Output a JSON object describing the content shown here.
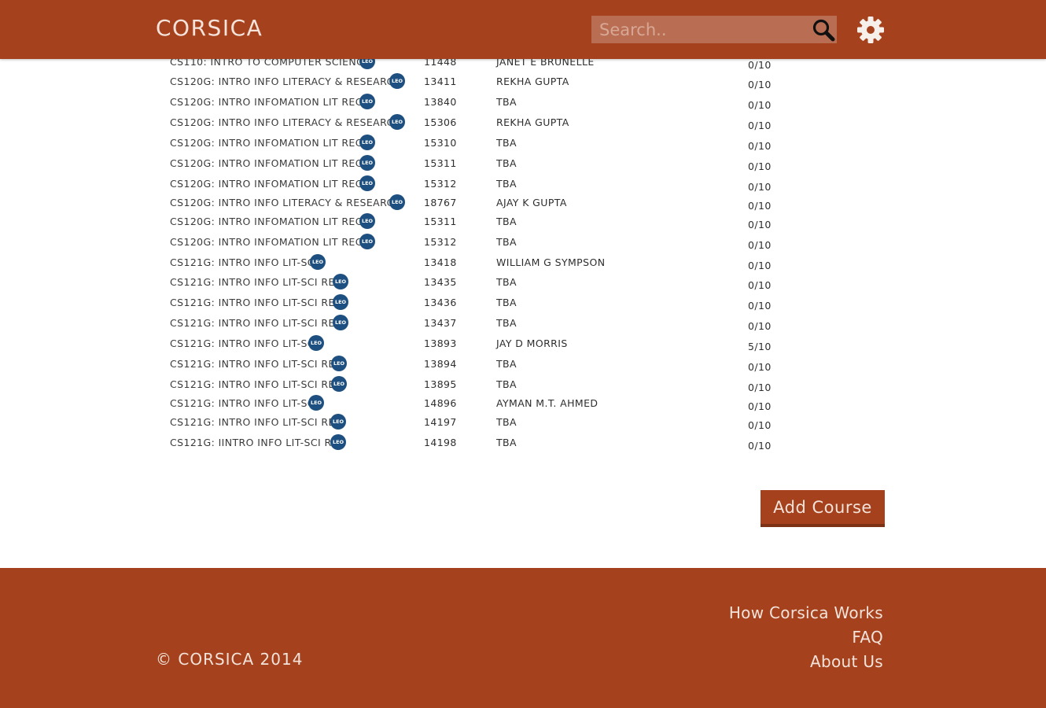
{
  "header": {
    "brand": "CORSICA",
    "search_placeholder": "Search..",
    "colors": {
      "brand": "#a5421d",
      "search_bg": "#b96d52",
      "header_text": "#f3e3da"
    }
  },
  "leo_badge": "LEO",
  "courses": [
    {
      "name": "CS110: INTRO TO COMPUTER SCIENCE",
      "leo": true,
      "number": "11448",
      "instructor": "JANET E BRUNELLE",
      "seats": "0/10"
    },
    {
      "name": "CS120G: INTRO INFO LITERACY & RESEARCH",
      "leo": true,
      "number": "13411",
      "instructor": "REKHA GUPTA",
      "seats": "0/10"
    },
    {
      "name": "CS120G: INTRO INFOMATION LIT REC",
      "leo": true,
      "number": "13840",
      "instructor": "TBA",
      "seats": "0/10"
    },
    {
      "name": "CS120G: INTRO INFO LITERACY & RESEARCH",
      "leo": true,
      "number": "15306",
      "instructor": "REKHA GUPTA",
      "seats": "0/10"
    },
    {
      "name": "CS120G: INTRO INFOMATION LIT REC",
      "leo": true,
      "number": "15310",
      "instructor": "TBA",
      "seats": "0/10"
    },
    {
      "name": "CS120G: INTRO INFOMATION LIT REC",
      "leo": true,
      "number": "15311",
      "instructor": "TBA",
      "seats": "0/10"
    },
    {
      "name": "CS120G: INTRO INFOMATION LIT REC",
      "leo": true,
      "number": "15312",
      "instructor": "TBA",
      "seats": "0/10"
    },
    {
      "name": "CS120G: INTRO INFO LITERACY & RESEARCH",
      "leo": true,
      "number": "18767",
      "instructor": "AJAY K GUPTA",
      "seats": "0/10"
    },
    {
      "name": "CS120G: INTRO INFOMATION LIT REC",
      "leo": true,
      "number": "15311",
      "instructor": "TBA",
      "seats": "0/10"
    },
    {
      "name": "CS120G: INTRO INFOMATION LIT REC",
      "leo": true,
      "number": "15312",
      "instructor": "TBA",
      "seats": "0/10"
    },
    {
      "name": "CS121G: INTRO INFO LIT-SCI",
      "leo": true,
      "number": "13418",
      "instructor": "WILLIAM G SYMPSON",
      "seats": "0/10"
    },
    {
      "name": "CS121G: INTRO INFO LIT-SCI REC",
      "leo": true,
      "number": "13435",
      "instructor": "TBA",
      "seats": "0/10"
    },
    {
      "name": "CS121G: INTRO INFO LIT-SCI REC",
      "leo": true,
      "number": "13436",
      "instructor": "TBA",
      "seats": "0/10"
    },
    {
      "name": "CS121G: INTRO INFO LIT-SCI REC",
      "leo": true,
      "number": "13437",
      "instructor": "TBA",
      "seats": "0/10"
    },
    {
      "name": "CS121G: INTRO INFO LIT-SCI",
      "leo": true,
      "number": "13893",
      "instructor": "JAY D MORRIS",
      "seats": "5/10"
    },
    {
      "name": "CS121G: INTRO INFO LIT-SCI REC",
      "leo": true,
      "number": "13894",
      "instructor": "TBA",
      "seats": "0/10"
    },
    {
      "name": "CS121G: INTRO INFO LIT-SCI REC",
      "leo": true,
      "number": "13895",
      "instructor": "TBA",
      "seats": "0/10"
    },
    {
      "name": "CS121G: INTRO INFO LIT-SCI",
      "leo": true,
      "number": "14896",
      "instructor": "AYMAN M.T. AHMED",
      "seats": "0/10"
    },
    {
      "name": "CS121G: INTRO INFO LIT-SCI REC",
      "leo": true,
      "number": "14197",
      "instructor": "TBA",
      "seats": "0/10"
    },
    {
      "name": "CS121G: IINTRO INFO LIT-SCI REC",
      "leo": true,
      "number": "14198",
      "instructor": "TBA",
      "seats": "0/10"
    }
  ],
  "add_course_label": "Add Course",
  "footer": {
    "copyright": "© CORSICA 2014",
    "links": [
      "How Corsica Works",
      "FAQ",
      "About Us"
    ]
  }
}
